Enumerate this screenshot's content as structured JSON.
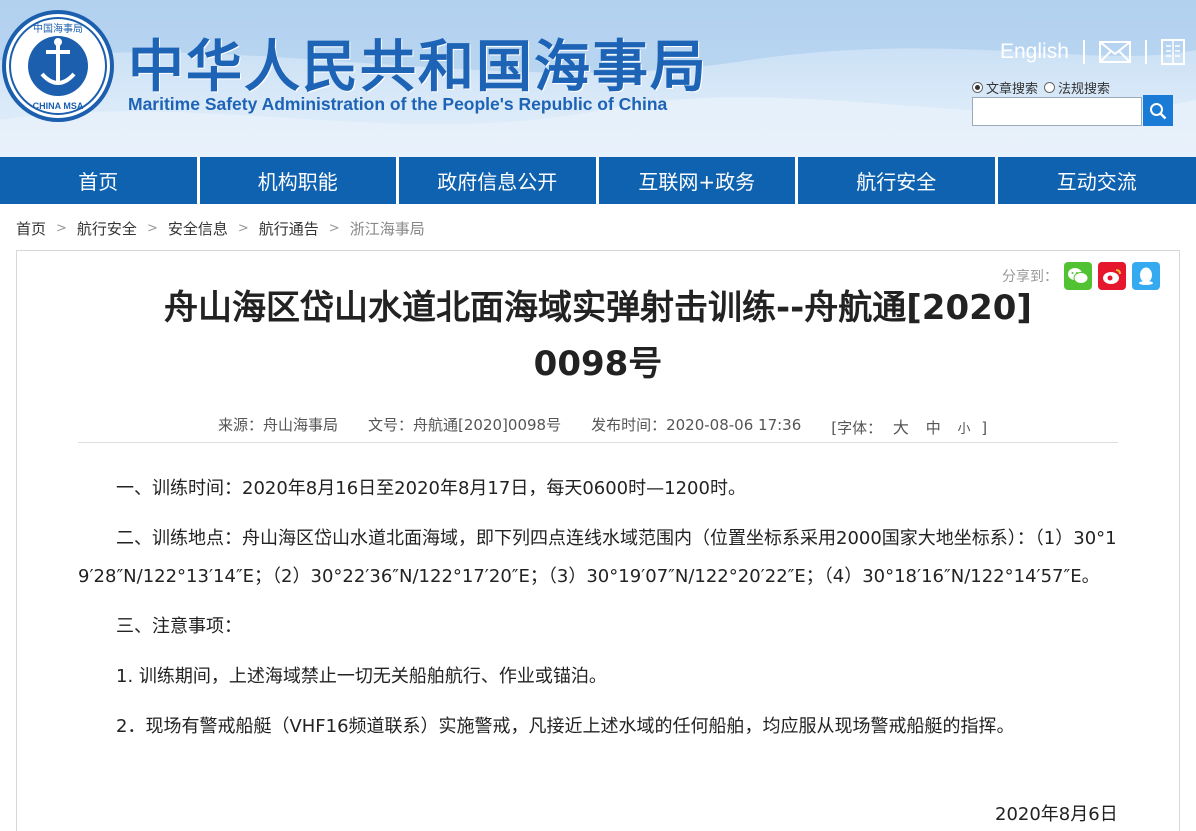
{
  "header": {
    "logo_text_top": "中国海事局",
    "logo_text_bottom": "CHINA MSA",
    "title": "中华人民共和国海事局",
    "subtitle": "Maritime Safety Administration of the People's Republic of China",
    "english_link": "English",
    "search_options": [
      {
        "label": "文章搜索",
        "selected": true
      },
      {
        "label": "法规搜索",
        "selected": false
      }
    ],
    "search_value": ""
  },
  "nav": {
    "items": [
      "首页",
      "机构职能",
      "政府信息公开",
      "互联网+政务",
      "航行安全",
      "互动交流"
    ]
  },
  "breadcrumb": {
    "items": [
      "首页",
      "航行安全",
      "安全信息",
      "航行通告",
      "浙江海事局"
    ],
    "separator": ">"
  },
  "share": {
    "label": "分享到：",
    "icons": [
      "wechat-icon",
      "weibo-icon",
      "qq-icon"
    ],
    "colors": {
      "wechat": "#51c332",
      "weibo": "#e6162d",
      "qq": "#35aaf0"
    }
  },
  "article": {
    "title": "舟山海区岱山水道北面海域实弹射击训练--舟航通[2020]0098号",
    "source": "来源：舟山海事局",
    "doc_no": "文号：舟航通[2020]0098号",
    "publish_time": "发布时间：2020-08-06 17:36",
    "font_label": "[字体：",
    "font_large": "大",
    "font_medium": "中",
    "font_small": "小",
    "font_end": "]",
    "paragraphs": [
      "一、训练时间：2020年8月16日至2020年8月17日，每天0600时—1200时。",
      "二、训练地点：舟山海区岱山水道北面海域，即下列四点连线水域范围内（位置坐标系采用2000国家大地坐标系）：（1）30°19′28″N/122°13′14″E；（2）30°22′36″N/122°17′20″E；（3）30°19′07″N/122°20′22″E；（4）30°18′16″N/122°14′57″E。",
      "三、注意事项：",
      "1. 训练期间，上述海域禁止一切无关船舶航行、作业或锚泊。",
      "2．现场有警戒船艇（VHF16频道联系）实施警戒，凡接近上述水域的任何船舶，均应服从现场警戒船艇的指挥。"
    ],
    "date": "2020年8月6日"
  },
  "colors": {
    "brand_blue": "#1d63b6",
    "nav_blue": "#0f62b0",
    "search_button": "#1a7bd6"
  }
}
